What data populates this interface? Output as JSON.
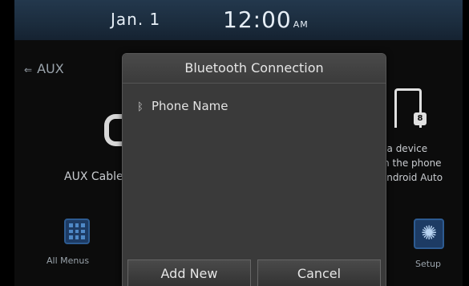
{
  "status": {
    "date": "Jan. 1",
    "time": "12:00",
    "ampm": "AM"
  },
  "home": {
    "source": "AUX",
    "aux_label": "AUX Cable",
    "device_text": "t a device\nm the phone\nAndroid Auto",
    "all_menus_label": "All Menus",
    "setup_label": "Setup"
  },
  "dialog": {
    "title": "Bluetooth Connection",
    "device_name": "Phone Name",
    "add_new_label": "Add New",
    "cancel_label": "Cancel"
  },
  "colors": {
    "statusbar": "#1b2c3d",
    "accent": "#2d5b91",
    "dialog_bg": "#3a3a3a"
  },
  "icons": {
    "aux": "aux-cable-icon",
    "phone": "phone-lock-icon",
    "grid": "menu-grid-icon",
    "gear": "gear-icon",
    "bluetooth": "bluetooth-icon"
  }
}
